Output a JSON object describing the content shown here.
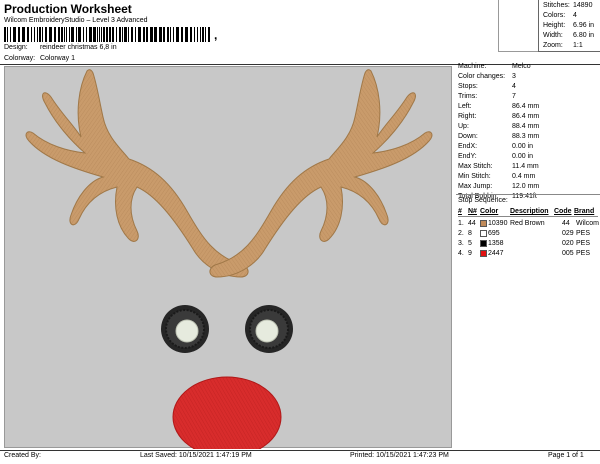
{
  "header": {
    "title": "Production Worksheet",
    "subtitle": "Wilcom EmbroideryStudio – Level 3 Advanced",
    "design_label": "Design:",
    "design_value": "reindeer christmas 6,8 in",
    "colorway_label": "Colorway:",
    "colorway_value": "Colorway 1",
    "barcode_tail": ","
  },
  "summary": {
    "stitches_label": "Stitches:",
    "stitches": "14890",
    "colors_label": "Colors:",
    "colors": "4",
    "height_label": "Height:",
    "height": "6.96 in",
    "width_label": "Width:",
    "width": "6.80 in",
    "zoom_label": "Zoom:",
    "zoom": "1:1"
  },
  "info": {
    "machine_label": "Machine:",
    "machine": "Melco",
    "color_changes_label": "Color changes:",
    "color_changes": "3",
    "stops_label": "Stops:",
    "stops": "4",
    "trims_label": "Trims:",
    "trims": "7",
    "left_label": "Left:",
    "left": "86.4 mm",
    "right_label": "Right:",
    "right": "86.4 mm",
    "up_label": "Up:",
    "up": "88.4 mm",
    "down_label": "Down:",
    "down": "88.3 mm",
    "endx_label": "EndX:",
    "endx": "0.00 in",
    "endy_label": "EndY:",
    "endy": "0.00 in",
    "max_stitch_label": "Max Stitch:",
    "max_stitch": "11.4 mm",
    "min_stitch_label": "Min Stitch:",
    "min_stitch": "0.4 mm",
    "max_jump_label": "Max Jump:",
    "max_jump": "12.0 mm",
    "total_bobbin_label": "Total Bobbin:",
    "total_bobbin": "119.41ft",
    "stop_sequence_label": "Stop Sequence:"
  },
  "stop_table": {
    "headers": [
      "#",
      "N#",
      "Color",
      "Description",
      "Code",
      "Brand"
    ],
    "rows": [
      {
        "seq": "1.",
        "needle": "44",
        "color": "#c08a5a",
        "stitches": "10390",
        "description": "Red Brown",
        "code": "44",
        "brand": "Wilcom"
      },
      {
        "seq": "2.",
        "needle": "8",
        "color": "#ffffff",
        "stitches": "695",
        "description": "",
        "code": "029",
        "brand": "PES"
      },
      {
        "seq": "3.",
        "needle": "5",
        "color": "#000000",
        "stitches": "1358",
        "description": "",
        "code": "020",
        "brand": "PES"
      },
      {
        "seq": "4.",
        "needle": "9",
        "color": "#e01010",
        "stitches": "2447",
        "description": "",
        "code": "005",
        "brand": "PES"
      }
    ]
  },
  "footer": {
    "created_by": "Created By:",
    "last_saved": "Last Saved: 10/15/2021 1:47:19 PM",
    "printed": "Printed: 10/15/2021 1:47:23 PM",
    "page": "Page 1 of 1"
  },
  "colors": {
    "canvas_bg": "#c8c8c8",
    "antler": "#c89a6a",
    "antler_dark": "#a87a4e",
    "eye_ring": "#2a2a2a",
    "eye_white": "#e8ece0",
    "nose": "#d42a2a"
  }
}
